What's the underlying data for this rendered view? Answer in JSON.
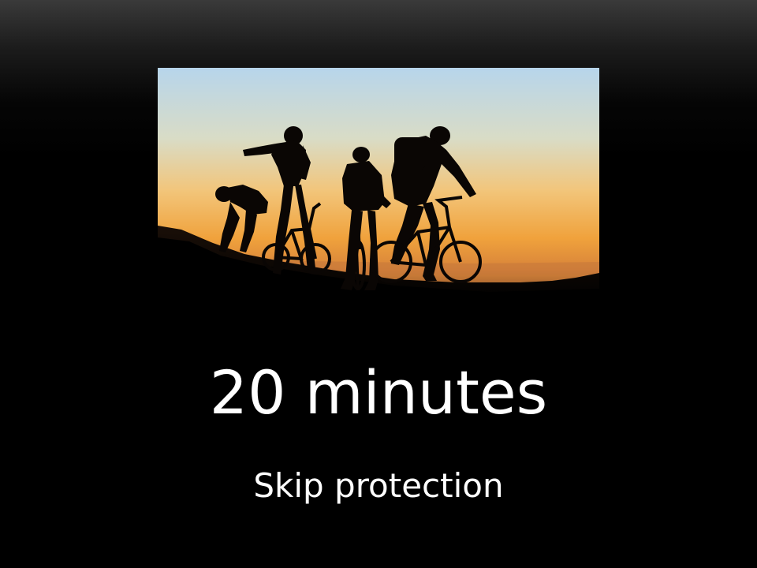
{
  "slide": {
    "title": "20 minutes",
    "subtitle": "Skip protection"
  },
  "photo": {
    "subject": "cyclists-silhouette-sunset"
  },
  "colors": {
    "background": "#000000",
    "text": "#ffffff",
    "sky_top": "#b9d6ea",
    "sky_bottom": "#f0a23c"
  }
}
